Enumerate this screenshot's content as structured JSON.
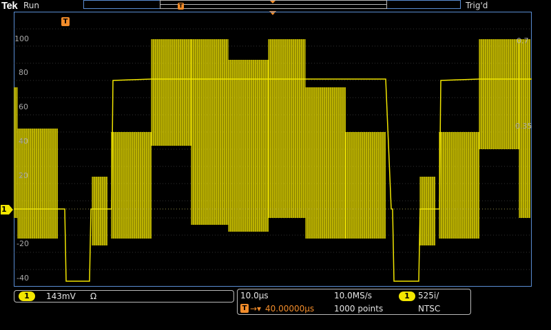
{
  "header": {
    "brand": "Tek",
    "run_state": "Run",
    "trigger_state": "Trig'd"
  },
  "graticule": {
    "left_labels": [
      "100",
      "80",
      "60",
      "40",
      "20",
      "-20",
      "-40"
    ],
    "right_labels": [
      "0.7",
      "0.35"
    ]
  },
  "channel_panel": {
    "channel": "1",
    "scale": "143mV",
    "impedance_symbol": "Ω"
  },
  "acquisition_panel": {
    "timebase": "10.0µs",
    "trigger_position": "40.00000µs",
    "sample_rate": "10.0MS/s",
    "record_length": "1000 points",
    "trigger_channel": "1",
    "video_format": "525i/",
    "video_standard": "NTSC"
  },
  "markers": {
    "channel_1": "1",
    "trigger": "T"
  },
  "colors": {
    "trace": "#f2e600",
    "trigger": "#f28c2a",
    "record_bar": "#5b8fd6"
  }
}
